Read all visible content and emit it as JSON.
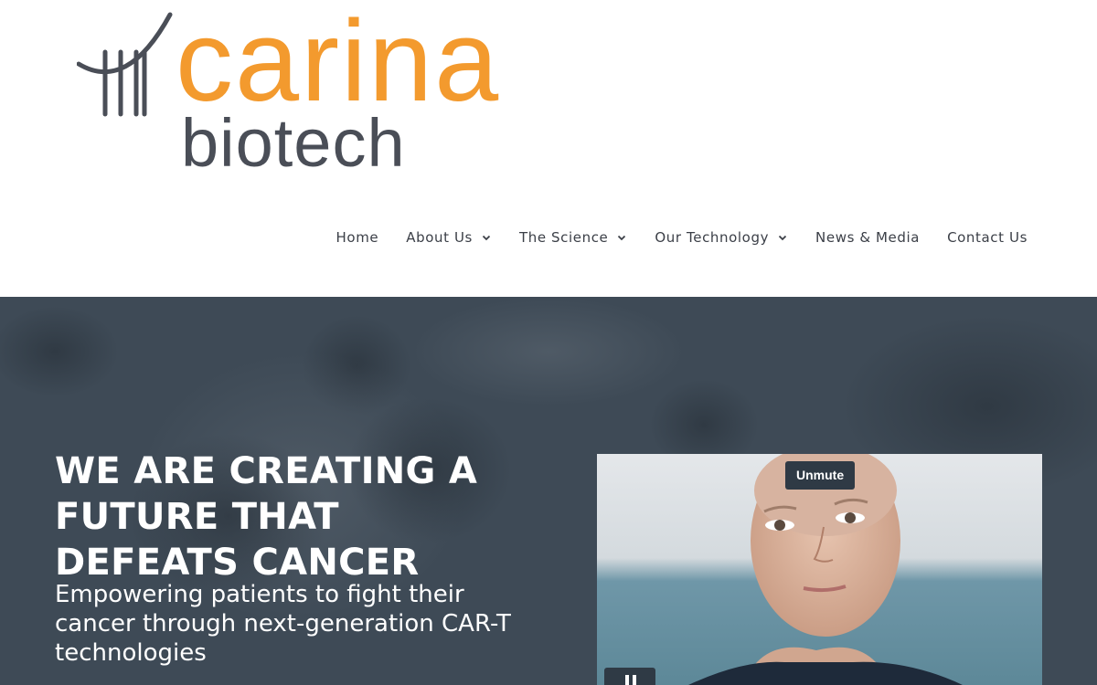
{
  "brand": {
    "name_primary": "carina",
    "name_secondary": "biotech",
    "primary_color": "#f39a2e",
    "secondary_color": "#4a4e57"
  },
  "nav": {
    "items": [
      {
        "label": "Home",
        "has_dropdown": false
      },
      {
        "label": "About Us",
        "has_dropdown": true
      },
      {
        "label": "The Science",
        "has_dropdown": true
      },
      {
        "label": "Our Technology",
        "has_dropdown": true
      },
      {
        "label": "News & Media",
        "has_dropdown": false
      },
      {
        "label": "Contact Us",
        "has_dropdown": false
      }
    ]
  },
  "hero": {
    "title": "WE ARE CREATING A FUTURE THAT DEFEATS CANCER",
    "subtitle": "Empowering patients to fight their cancer through next-generation CAR-T technologies",
    "background_color": "#3e4a56",
    "video": {
      "unmute_label": "Unmute",
      "pause_icon": "pause-icon"
    }
  }
}
